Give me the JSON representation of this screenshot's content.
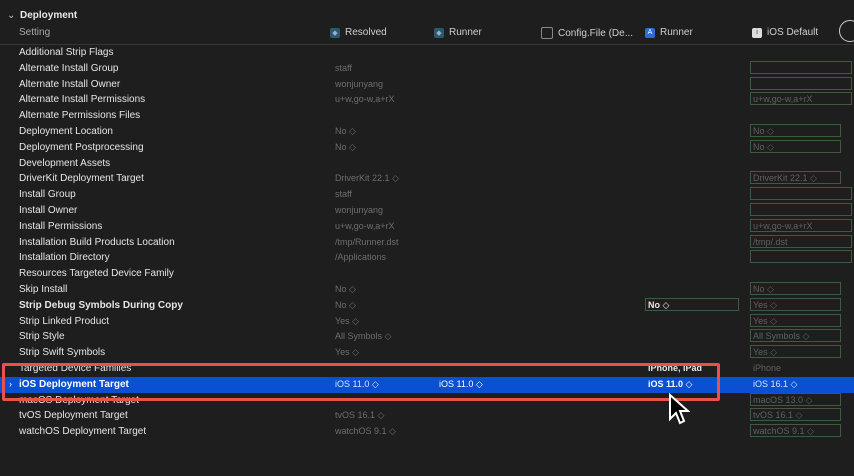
{
  "section": {
    "title": "Deployment"
  },
  "columns": {
    "setting": "Setting",
    "resolved": "Resolved",
    "runner1": "Runner",
    "config": "Config.File (De...",
    "runner2": "Runner",
    "ios_default": "iOS Default"
  },
  "rows": [
    {
      "name": "Additional Strip Flags",
      "resolved": "",
      "runner1": "",
      "runner2": "",
      "ios": ""
    },
    {
      "name": "Alternate Install Group",
      "resolved": "staff",
      "runner1": "",
      "runner2": "",
      "ios": ""
    },
    {
      "name": "Alternate Install Owner",
      "resolved": "wonjunyang",
      "runner1": "",
      "runner2": "",
      "ios": ""
    },
    {
      "name": "Alternate Install Permissions",
      "resolved": "u+w,go-w,a+rX",
      "runner1": "",
      "runner2": "",
      "ios": "u+w,go-w,a+rX"
    },
    {
      "name": "Alternate Permissions Files",
      "resolved": "",
      "runner1": "",
      "runner2": "",
      "ios": ""
    },
    {
      "name": "Deployment Location",
      "resolved": "No ◇",
      "runner1": "",
      "runner2": "",
      "ios": "No ◇"
    },
    {
      "name": "Deployment Postprocessing",
      "resolved": "No ◇",
      "runner1": "",
      "runner2": "",
      "ios": "No ◇"
    },
    {
      "name": "Development Assets",
      "resolved": "",
      "runner1": "",
      "runner2": "",
      "ios": ""
    },
    {
      "name": "DriverKit Deployment Target",
      "resolved": "DriverKit 22.1 ◇",
      "runner1": "",
      "runner2": "",
      "ios": "DriverKit 22.1 ◇"
    },
    {
      "name": "Install Group",
      "resolved": "staff",
      "runner1": "",
      "runner2": "",
      "ios": ""
    },
    {
      "name": "Install Owner",
      "resolved": "wonjunyang",
      "runner1": "",
      "runner2": "",
      "ios": ""
    },
    {
      "name": "Install Permissions",
      "resolved": "u+w,go-w,a+rX",
      "runner1": "",
      "runner2": "",
      "ios": "u+w,go-w,a+rX"
    },
    {
      "name": "Installation Build Products Location",
      "resolved": "/tmp/Runner.dst",
      "runner1": "",
      "runner2": "",
      "ios": "/tmp/.dst"
    },
    {
      "name": "Installation Directory",
      "resolved": "/Applications",
      "runner1": "",
      "runner2": "",
      "ios": ""
    },
    {
      "name": "Resources Targeted Device Family",
      "resolved": "",
      "runner1": "",
      "runner2": "",
      "ios": ""
    },
    {
      "name": "Skip Install",
      "resolved": "No ◇",
      "runner1": "",
      "runner2": "",
      "ios": "No ◇"
    },
    {
      "name": "Strip Debug Symbols During Copy",
      "resolved": "No ◇",
      "runner1": "",
      "runner2": "No ◇",
      "ios": "Yes ◇",
      "bold": true
    },
    {
      "name": "Strip Linked Product",
      "resolved": "Yes ◇",
      "runner1": "",
      "runner2": "",
      "ios": "Yes ◇"
    },
    {
      "name": "Strip Style",
      "resolved": "All Symbols ◇",
      "runner1": "",
      "runner2": "",
      "ios": "All Symbols ◇"
    },
    {
      "name": "Strip Swift Symbols",
      "resolved": "Yes ◇",
      "runner1": "",
      "runner2": "",
      "ios": "Yes ◇"
    },
    {
      "name": "Targeted Device Families",
      "resolved": "",
      "runner1": "",
      "runner2": "iPhone, iPad",
      "ios": "iPhone"
    },
    {
      "name": "iOS Deployment Target",
      "resolved": "iOS 11.0 ◇",
      "runner1": "iOS 11.0 ◇",
      "runner2": "iOS 11.0 ◇",
      "ios": "iOS 16.1 ◇",
      "selected": true
    },
    {
      "name": "macOS Deployment Target",
      "resolved": "",
      "runner1": "",
      "runner2": "",
      "ios": "macOS 13.0 ◇"
    },
    {
      "name": "tvOS Deployment Target",
      "resolved": "tvOS 16.1 ◇",
      "runner1": "",
      "runner2": "",
      "ios": "tvOS 16.1 ◇"
    },
    {
      "name": "watchOS Deployment Target",
      "resolved": "watchOS 9.1 ◇",
      "runner1": "",
      "runner2": "",
      "ios": "watchOS 9.1 ◇"
    }
  ],
  "colors": {
    "background": "#1e1e1e",
    "selection": "#0b4fd2",
    "highlight_border": "#e8524a",
    "field_border": "#3f5b3f"
  }
}
